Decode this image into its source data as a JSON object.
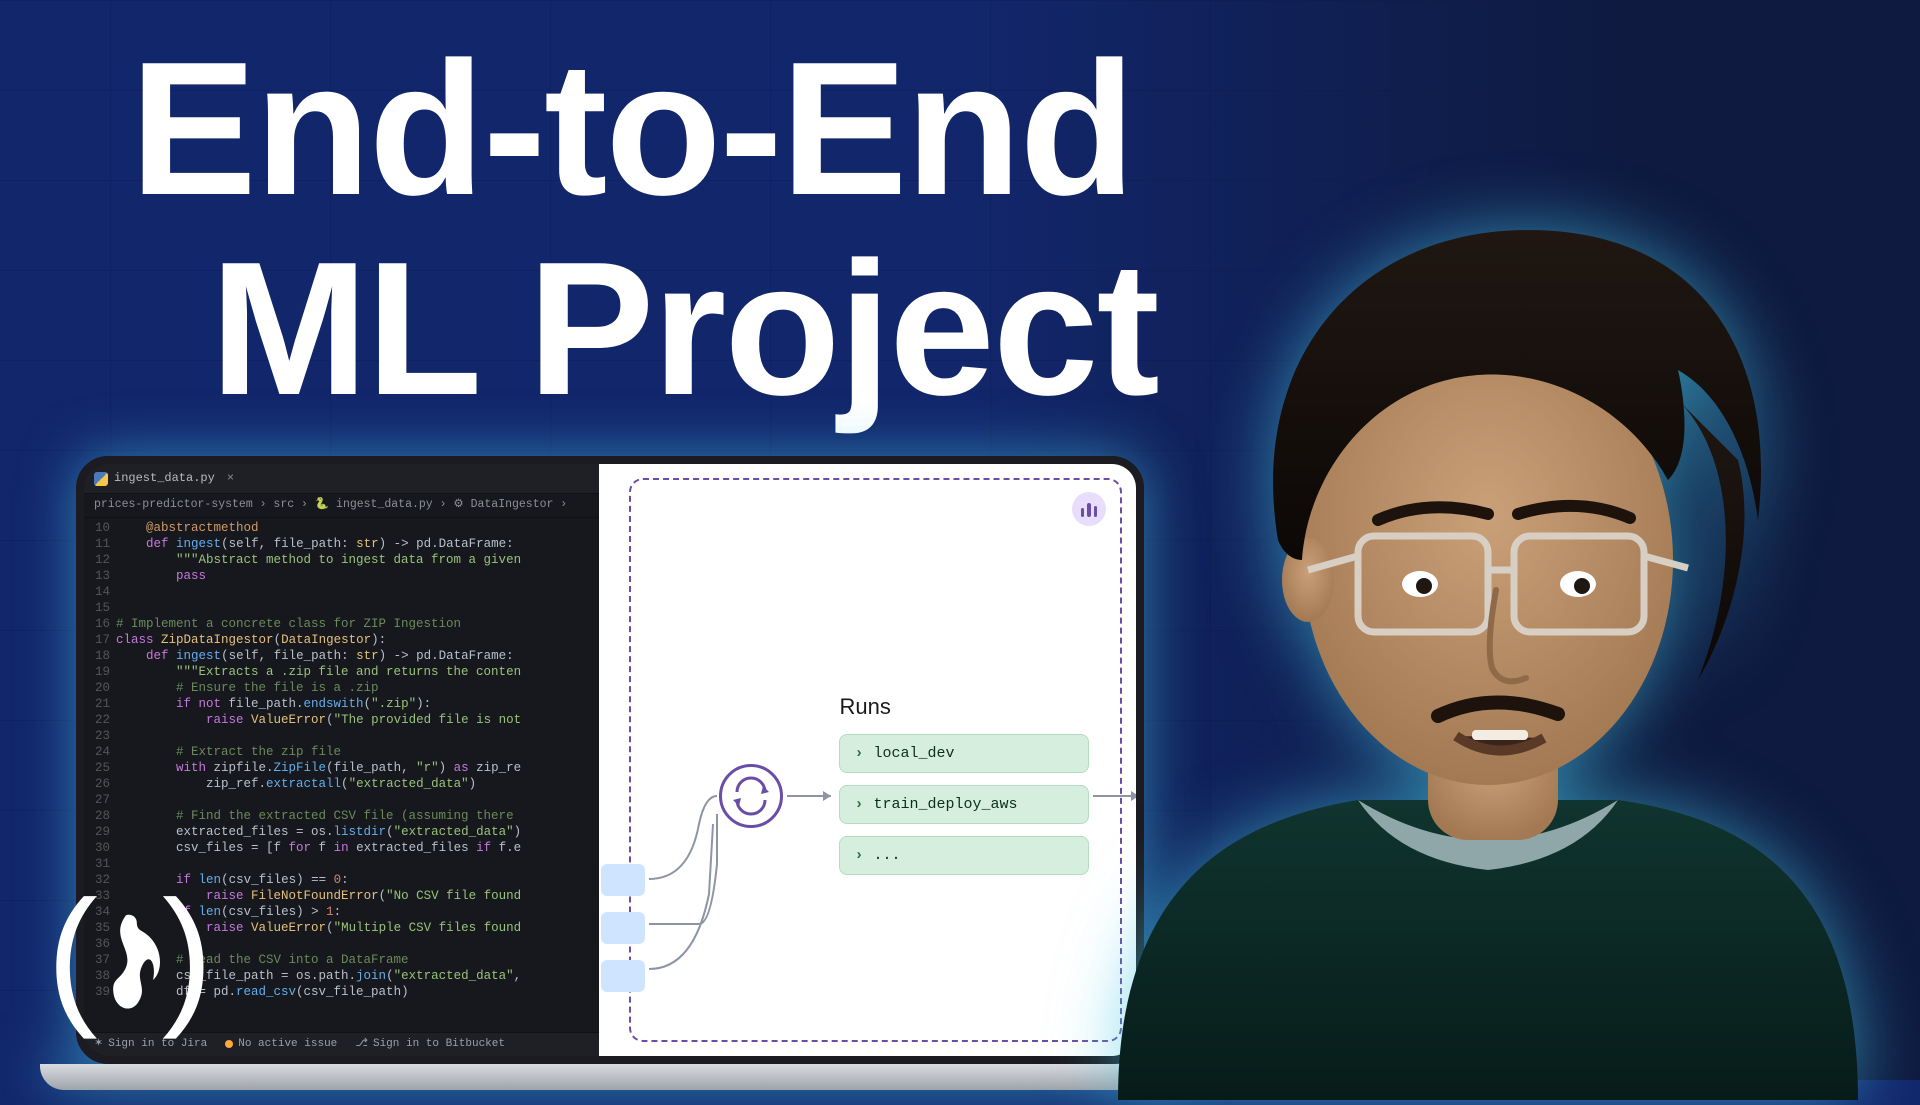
{
  "title": {
    "line1": "End-to-End",
    "line2": "ML Project"
  },
  "editor": {
    "filename": "ingest_data.py",
    "breadcrumb": "prices-predictor-system › src › 🐍 ingest_data.py › ⚙ DataIngestor ›",
    "line_start": 10,
    "lines": [
      {
        "cls": "dec",
        "text": "    @abstractmethod"
      },
      {
        "cls": "",
        "html": "    <span class='kw'>def</span> <span class='fn'>ingest</span>(self, file_path: <span class='cls'>str</span>) -> pd.DataFrame:"
      },
      {
        "cls": "str",
        "text": "        \"\"\"Abstract method to ingest data from a given"
      },
      {
        "cls": "kw",
        "text": "        pass"
      },
      {
        "cls": "",
        "text": ""
      },
      {
        "cls": "",
        "text": ""
      },
      {
        "cls": "cm",
        "text": "# Implement a concrete class for ZIP Ingestion"
      },
      {
        "cls": "",
        "html": "<span class='kw'>class</span> <span class='cls'>ZipDataIngestor</span>(<span class='cls'>DataIngestor</span>):"
      },
      {
        "cls": "",
        "html": "    <span class='kw'>def</span> <span class='fn'>ingest</span>(self, file_path: <span class='cls'>str</span>) -> pd.DataFrame:"
      },
      {
        "cls": "str",
        "text": "        \"\"\"Extracts a .zip file and returns the conten"
      },
      {
        "cls": "cm",
        "text": "        # Ensure the file is a .zip"
      },
      {
        "cls": "",
        "html": "        <span class='kw'>if not</span> file_path.<span class='fn'>endswith</span>(<span class='str'>\".zip\"</span>):"
      },
      {
        "cls": "",
        "html": "            <span class='kw'>raise</span> <span class='cls'>ValueError</span>(<span class='str'>\"The provided file is not</span>"
      },
      {
        "cls": "",
        "text": ""
      },
      {
        "cls": "cm",
        "text": "        # Extract the zip file"
      },
      {
        "cls": "",
        "html": "        <span class='kw'>with</span> zipfile.<span class='fn'>ZipFile</span>(file_path, <span class='str'>\"r\"</span>) <span class='kw'>as</span> zip_re"
      },
      {
        "cls": "",
        "html": "            zip_ref.<span class='fn'>extractall</span>(<span class='str'>\"extracted_data\"</span>)"
      },
      {
        "cls": "",
        "text": ""
      },
      {
        "cls": "cm",
        "text": "        # Find the extracted CSV file (assuming there "
      },
      {
        "cls": "",
        "html": "        extracted_files = os.<span class='fn'>listdir</span>(<span class='str'>\"extracted_data\"</span>)"
      },
      {
        "cls": "",
        "html": "        csv_files = [f <span class='kw'>for</span> f <span class='kw'>in</span> extracted_files <span class='kw'>if</span> f.e"
      },
      {
        "cls": "",
        "text": ""
      },
      {
        "cls": "",
        "html": "        <span class='kw'>if</span> <span class='fn'>len</span>(csv_files) == <span class='num'>0</span>:"
      },
      {
        "cls": "",
        "html": "            <span class='kw'>raise</span> <span class='cls'>FileNotFoundError</span>(<span class='str'>\"No CSV file found</span>"
      },
      {
        "cls": "",
        "html": "        <span class='kw'>if</span> <span class='fn'>len</span>(csv_files) > <span class='num'>1</span>:"
      },
      {
        "cls": "",
        "html": "            <span class='kw'>raise</span> <span class='cls'>ValueError</span>(<span class='str'>\"Multiple CSV files found</span>"
      },
      {
        "cls": "",
        "text": ""
      },
      {
        "cls": "cm",
        "text": "        # Read the CSV into a DataFrame"
      },
      {
        "cls": "",
        "html": "        csv_file_path = os.path.<span class='fn'>join</span>(<span class='str'>\"extracted_data\"</span>,"
      },
      {
        "cls": "",
        "html": "        df = pd.<span class='fn'>read_csv</span>(csv_file_path)"
      }
    ],
    "status": {
      "jira": "Sign in to Jira",
      "issue": "No active issue",
      "bitbucket": "Sign in to Bitbucket"
    }
  },
  "diagram": {
    "runs_title": "Runs",
    "runs": [
      "local_dev",
      "train_deploy_aws",
      "..."
    ]
  }
}
